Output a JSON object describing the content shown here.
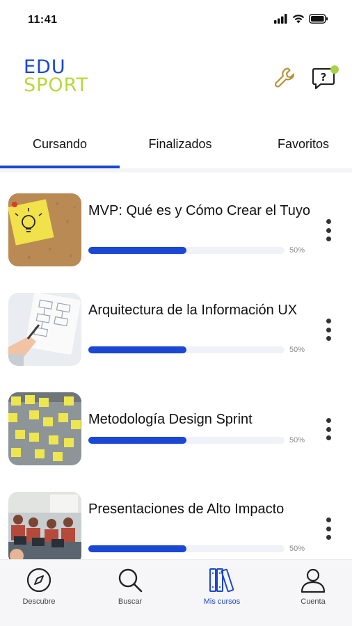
{
  "status_bar": {
    "time": "11:41"
  },
  "brand": {
    "line1": "EDU",
    "line2": "SPORT"
  },
  "tabs": [
    {
      "label": "Cursando",
      "active": true
    },
    {
      "label": "Finalizados",
      "active": false
    },
    {
      "label": "Favoritos",
      "active": false
    }
  ],
  "courses": [
    {
      "title": "MVP: Qué es y Cómo Crear el Tuyo",
      "progress_label": "50%",
      "progress": 0.5
    },
    {
      "title": "Arquitectura de la Información UX",
      "progress_label": "50%",
      "progress": 0.5
    },
    {
      "title": "Metodología Design Sprint",
      "progress_label": "50%",
      "progress": 0.5
    },
    {
      "title": "Presentaciones de Alto Impacto",
      "progress_label": "50%",
      "progress": 0.5
    }
  ],
  "bottom_nav": [
    {
      "label": "Descubre",
      "icon": "compass-icon",
      "active": false
    },
    {
      "label": "Buscar",
      "icon": "search-icon",
      "active": false
    },
    {
      "label": "Mis cursos",
      "icon": "books-icon",
      "active": true
    },
    {
      "label": "Cuenta",
      "icon": "user-icon",
      "active": false
    }
  ],
  "colors": {
    "accent": "#1a47d4",
    "brand_green": "#b7d83a",
    "notification": "#a8d24a"
  }
}
